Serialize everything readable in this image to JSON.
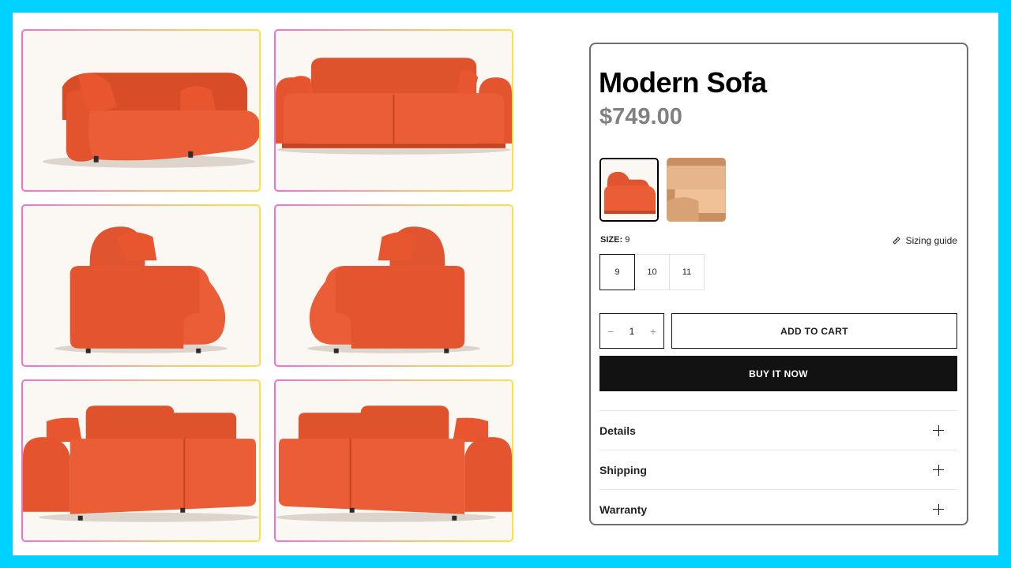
{
  "gallery": {
    "images": [
      {
        "name": "sofa-angled-left-view"
      },
      {
        "name": "sofa-front-view"
      },
      {
        "name": "sofa-side-view-right"
      },
      {
        "name": "sofa-side-view-left"
      },
      {
        "name": "sofa-back-angled-left"
      },
      {
        "name": "sofa-back-angled-right"
      }
    ]
  },
  "product": {
    "title": "Modern Sofa",
    "price": "$749.00",
    "size_label": "SIZE:",
    "size_value": "9",
    "sizing_guide": "Sizing guide",
    "sizes": [
      "9",
      "10",
      "11"
    ],
    "selected_size": "9",
    "quantity": "1",
    "add_to_cart": "ADD TO CART",
    "buy_now": "BUY IT NOW",
    "accordions": [
      "Details",
      "Shipping",
      "Warranty"
    ]
  },
  "colors": {
    "frame": "#00d2ff",
    "sofa": "#e8562f",
    "sofa_alt": "#d9a57c",
    "button_dark": "#121212",
    "price": "#808080"
  },
  "icons": {
    "sizing_guide": "ruler-icon",
    "qty_decrease": "minus-icon",
    "qty_increase": "plus-icon",
    "accordion_toggle": "plus-icon"
  }
}
